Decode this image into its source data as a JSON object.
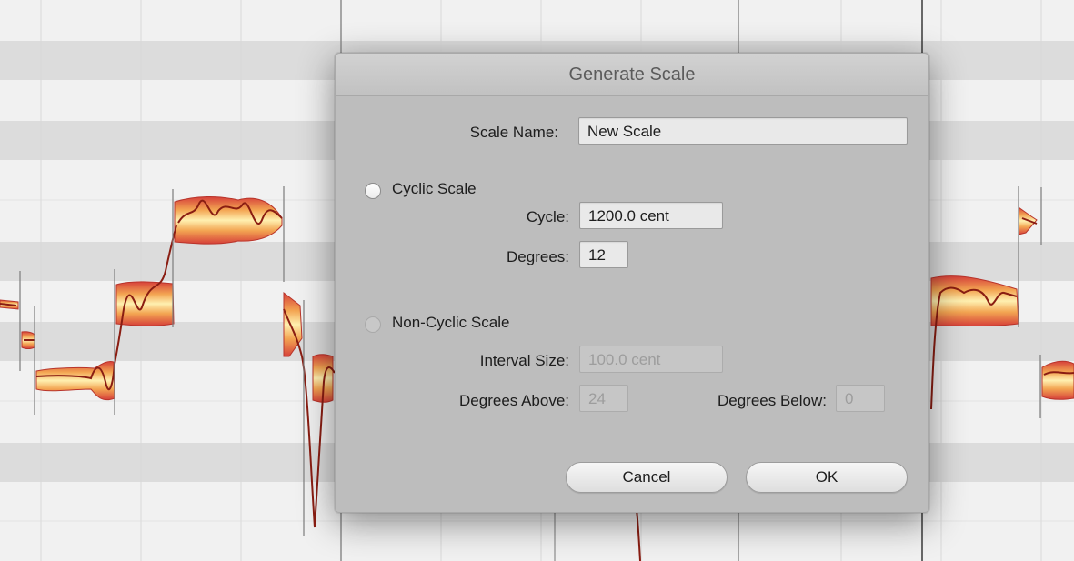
{
  "dialog": {
    "title": "Generate Scale",
    "scale_name": {
      "label": "Scale Name:",
      "value": "New Scale"
    },
    "cyclic": {
      "label": "Cyclic Scale",
      "selected": false,
      "cycle": {
        "label": "Cycle:",
        "value": "1200.0 cent"
      },
      "degrees": {
        "label": "Degrees:",
        "value": "12"
      }
    },
    "non_cyclic": {
      "label": "Non-Cyclic Scale",
      "enabled": false,
      "interval_size": {
        "label": "Interval Size:",
        "value": "100.0 cent"
      },
      "degrees_above": {
        "label": "Degrees Above:",
        "value": "24"
      },
      "degrees_below": {
        "label": "Degrees Below:",
        "value": "0"
      }
    },
    "buttons": {
      "cancel": "Cancel",
      "ok": "OK"
    }
  },
  "colors": {
    "editor_bg": "#ececec",
    "lane_dark": "#dddddd",
    "blob_fill_outer": "#d6403a",
    "blob_fill_inner": "#fff0b0",
    "pitch_line": "#8a1d12",
    "dialog_bg": "#bdbdbd"
  }
}
